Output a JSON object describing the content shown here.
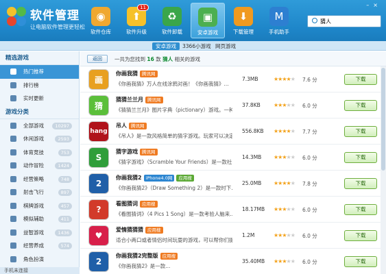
{
  "app": {
    "title": "软件管理",
    "subtitle": "让电脑软件管理更轻松"
  },
  "search": {
    "value": "猜人"
  },
  "nav": [
    {
      "label": "软件仓库",
      "icon": "disc-icon",
      "color": "#f0a830",
      "active": false,
      "badge": ""
    },
    {
      "label": "软件升级",
      "icon": "upgrade-icon",
      "color": "#f5c12a",
      "active": false,
      "badge": "11"
    },
    {
      "label": "软件卸载",
      "icon": "recycle-icon",
      "color": "#3aa64a",
      "active": false,
      "badge": ""
    },
    {
      "label": "安卓游戏",
      "icon": "android-bag-icon",
      "color": "#4caf50",
      "active": true,
      "badge": ""
    },
    {
      "label": "下载管理",
      "icon": "download-icon",
      "color": "#f09a20",
      "active": false,
      "badge": ""
    },
    {
      "label": "手机助手",
      "icon": "phone-assistant-icon",
      "color": "#2d7fd1",
      "active": false,
      "badge": ""
    }
  ],
  "subbar": {
    "tabs": [
      "安卓游戏",
      "3366小游戏",
      "网页游戏"
    ]
  },
  "sidebar": {
    "section1": "精选游戏",
    "featured": [
      {
        "label": "热门推荐",
        "active": true
      },
      {
        "label": "排行榜",
        "active": false
      },
      {
        "label": "实时更新",
        "active": false
      }
    ],
    "section2": "游戏分类",
    "categories": [
      {
        "label": "全部游戏",
        "count": "10297"
      },
      {
        "label": "休闲游戏",
        "count": "2593"
      },
      {
        "label": "体育竞技",
        "count": "753"
      },
      {
        "label": "动作冒险",
        "count": "1424"
      },
      {
        "label": "经营策略",
        "count": "748"
      },
      {
        "label": "射击飞行",
        "count": "897"
      },
      {
        "label": "棋牌游戏",
        "count": "457"
      },
      {
        "label": "模拟辅助",
        "count": "411"
      },
      {
        "label": "益智游戏",
        "count": "1436"
      },
      {
        "label": "经营养成",
        "count": "574"
      },
      {
        "label": "角色扮演",
        "count": ""
      }
    ],
    "footer": "手机未连接"
  },
  "crumb": {
    "back": "返回",
    "pre": "一共为您找到",
    "count": "16",
    "mid": "款",
    "keyword": "猜人",
    "post": "相关的游戏"
  },
  "apps": [
    {
      "name": "你画我猜",
      "tags": [
        {
          "t": "腾讯网",
          "c": ""
        }
      ],
      "desc": "《你画我猜》万人在线涂鸦对画！《你画我猜》...",
      "size": "7.3MB",
      "stars": 4,
      "score": "7.6 分",
      "btn": "下载",
      "color": "#e8a020",
      "glyph": "画"
    },
    {
      "name": "猜猜兰兰月",
      "tags": [
        {
          "t": "腾讯网",
          "c": ""
        }
      ],
      "desc": "《猜猜兰兰月》图片字典（pictionary）游戏。一种...",
      "size": "37.8KB",
      "stars": 3,
      "score": "6.0 分",
      "btn": "下载",
      "color": "#5bbf3a",
      "glyph": "猜"
    },
    {
      "name": "吊人",
      "tags": [
        {
          "t": "腾讯网",
          "c": ""
        }
      ],
      "desc": "《吊人》是一款风格简单的猜字游戏。玩家可以决定...",
      "size": "556.8KB",
      "stars": 4,
      "score": "7.7 分",
      "btn": "下载",
      "color": "#b0121a",
      "glyph": "hang"
    },
    {
      "name": "猜字游戏",
      "tags": [
        {
          "t": "腾讯网",
          "c": ""
        }
      ],
      "desc": "《猜字游戏》（Scramble Your Friends）是一款社...",
      "size": "14.3MB",
      "stars": 3,
      "score": "6.0 分",
      "btn": "下载",
      "color": "#2f9e3a",
      "glyph": "S"
    },
    {
      "name": "你画我猜2",
      "tags": [
        {
          "t": "iPhone4.0网",
          "c": "blue"
        },
        {
          "t": "应用搜",
          "c": "green"
        }
      ],
      "desc": "《你画我猜2》（Draw Something 2）是一款时下...",
      "size": "25.0MB",
      "stars": 4,
      "score": "7.8 分",
      "btn": "下载",
      "color": "#1f5fa8",
      "glyph": "2"
    },
    {
      "name": "看图猜词",
      "tags": [
        {
          "t": "应用搜",
          "c": ""
        }
      ],
      "desc": "《看图猜词》（4 Pics 1 Song）是一款考验人脑来...",
      "size": "18.17MB",
      "stars": 3,
      "score": "6.0 分",
      "btn": "下载",
      "color": "#d23a2a",
      "glyph": "?"
    },
    {
      "name": "爱情猜猜猜",
      "tags": [
        {
          "t": "应用搜",
          "c": ""
        }
      ],
      "desc": "适合小两口或者情侣时间玩耍的游戏，可以帮你们提高2个人...",
      "size": "1.2M",
      "stars": 3,
      "score": "6.0 分",
      "btn": "下载",
      "color": "#d81f4a",
      "glyph": "♥"
    },
    {
      "name": "你画我猜2完整版",
      "tags": [
        {
          "t": "应用搜",
          "c": ""
        }
      ],
      "desc": "《你画我猜2》是一款...",
      "size": "35.40MB",
      "stars": 3,
      "score": "6.0 分",
      "btn": "下载",
      "color": "#1f5fa8",
      "glyph": "2"
    }
  ]
}
